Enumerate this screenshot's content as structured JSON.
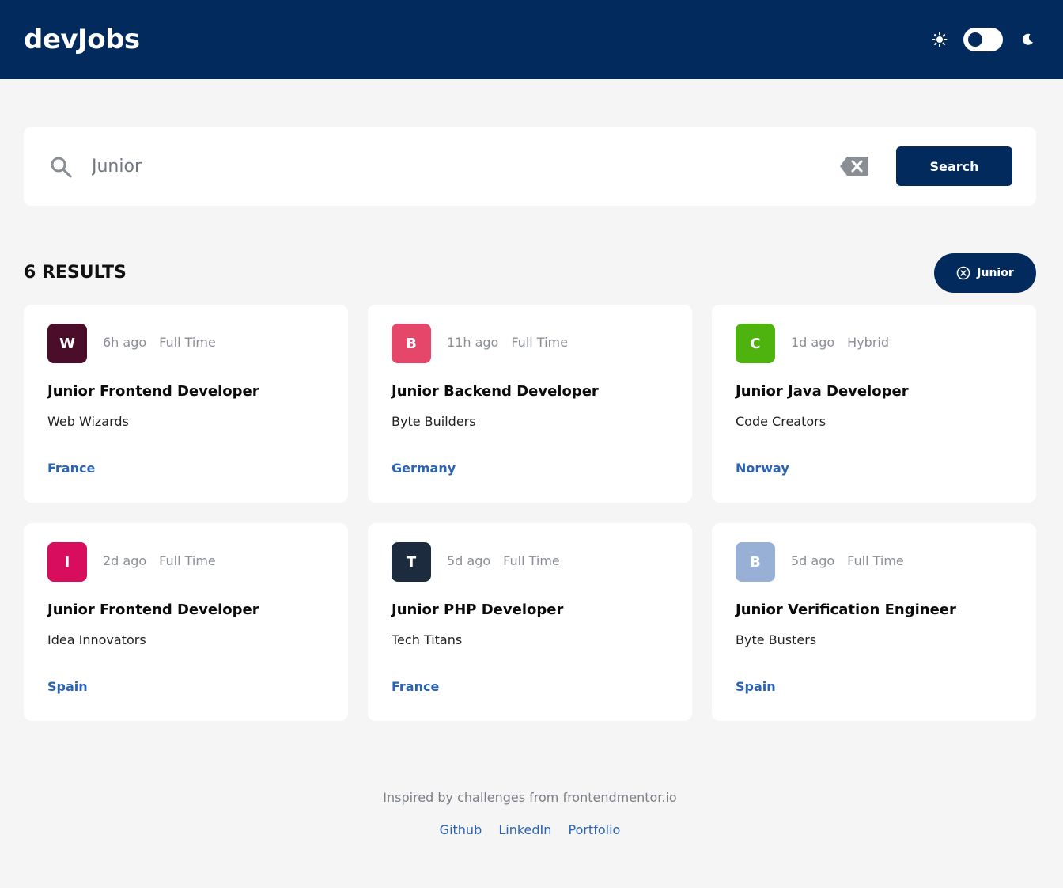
{
  "header": {
    "logo": "devJobs",
    "theme_toggle": {
      "state": "light",
      "icons": [
        "sun-icon",
        "moon-icon"
      ]
    }
  },
  "search": {
    "value": "Junior",
    "placeholder": "",
    "button_label": "Search",
    "icons": [
      "search-icon",
      "clear-icon"
    ]
  },
  "results": {
    "count_label": "6 RESULTS",
    "active_filter": "Junior"
  },
  "jobs": [
    {
      "logo_letter": "W",
      "logo_color": "#4a0d2a",
      "posted": "6h ago",
      "type": "Full Time",
      "title": "Junior Frontend Developer",
      "company": "Web Wizards",
      "location": "France"
    },
    {
      "logo_letter": "B",
      "logo_color": "#e4476a",
      "posted": "11h ago",
      "type": "Full Time",
      "title": "Junior Backend Developer",
      "company": "Byte Builders",
      "location": "Germany"
    },
    {
      "logo_letter": "C",
      "logo_color": "#4fb30f",
      "posted": "1d ago",
      "type": "Hybrid",
      "title": "Junior Java Developer",
      "company": "Code Creators",
      "location": "Norway"
    },
    {
      "logo_letter": "I",
      "logo_color": "#d80d5e",
      "posted": "2d ago",
      "type": "Full Time",
      "title": "Junior Frontend Developer",
      "company": "Idea Innovators",
      "location": "Spain"
    },
    {
      "logo_letter": "T",
      "logo_color": "#1c2b3e",
      "posted": "5d ago",
      "type": "Full Time",
      "title": "Junior PHP Developer",
      "company": "Tech Titans",
      "location": "France"
    },
    {
      "logo_letter": "B",
      "logo_color": "#98b0d6",
      "posted": "5d ago",
      "type": "Full Time",
      "title": "Junior Verification Engineer",
      "company": "Byte Busters",
      "location": "Spain"
    }
  ],
  "footer": {
    "credit": "Inspired by challenges from frontendmentor.io",
    "links": [
      "Github",
      "LinkedIn",
      "Portfolio"
    ]
  },
  "colors": {
    "brand": "#022a5c",
    "background": "#f5f5f5",
    "link": "#2a63b5"
  }
}
